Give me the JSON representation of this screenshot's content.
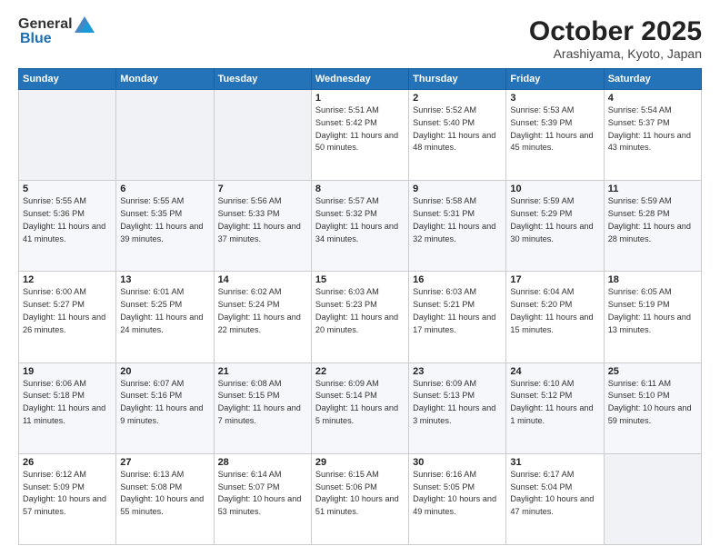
{
  "header": {
    "logo_general": "General",
    "logo_blue": "Blue",
    "month_title": "October 2025",
    "location": "Arashiyama, Kyoto, Japan"
  },
  "weekdays": [
    "Sunday",
    "Monday",
    "Tuesday",
    "Wednesday",
    "Thursday",
    "Friday",
    "Saturday"
  ],
  "weeks": [
    [
      {
        "day": "",
        "sunrise": "",
        "sunset": "",
        "daylight": ""
      },
      {
        "day": "",
        "sunrise": "",
        "sunset": "",
        "daylight": ""
      },
      {
        "day": "",
        "sunrise": "",
        "sunset": "",
        "daylight": ""
      },
      {
        "day": "1",
        "sunrise": "Sunrise: 5:51 AM",
        "sunset": "Sunset: 5:42 PM",
        "daylight": "Daylight: 11 hours and 50 minutes."
      },
      {
        "day": "2",
        "sunrise": "Sunrise: 5:52 AM",
        "sunset": "Sunset: 5:40 PM",
        "daylight": "Daylight: 11 hours and 48 minutes."
      },
      {
        "day": "3",
        "sunrise": "Sunrise: 5:53 AM",
        "sunset": "Sunset: 5:39 PM",
        "daylight": "Daylight: 11 hours and 45 minutes."
      },
      {
        "day": "4",
        "sunrise": "Sunrise: 5:54 AM",
        "sunset": "Sunset: 5:37 PM",
        "daylight": "Daylight: 11 hours and 43 minutes."
      }
    ],
    [
      {
        "day": "5",
        "sunrise": "Sunrise: 5:55 AM",
        "sunset": "Sunset: 5:36 PM",
        "daylight": "Daylight: 11 hours and 41 minutes."
      },
      {
        "day": "6",
        "sunrise": "Sunrise: 5:55 AM",
        "sunset": "Sunset: 5:35 PM",
        "daylight": "Daylight: 11 hours and 39 minutes."
      },
      {
        "day": "7",
        "sunrise": "Sunrise: 5:56 AM",
        "sunset": "Sunset: 5:33 PM",
        "daylight": "Daylight: 11 hours and 37 minutes."
      },
      {
        "day": "8",
        "sunrise": "Sunrise: 5:57 AM",
        "sunset": "Sunset: 5:32 PM",
        "daylight": "Daylight: 11 hours and 34 minutes."
      },
      {
        "day": "9",
        "sunrise": "Sunrise: 5:58 AM",
        "sunset": "Sunset: 5:31 PM",
        "daylight": "Daylight: 11 hours and 32 minutes."
      },
      {
        "day": "10",
        "sunrise": "Sunrise: 5:59 AM",
        "sunset": "Sunset: 5:29 PM",
        "daylight": "Daylight: 11 hours and 30 minutes."
      },
      {
        "day": "11",
        "sunrise": "Sunrise: 5:59 AM",
        "sunset": "Sunset: 5:28 PM",
        "daylight": "Daylight: 11 hours and 28 minutes."
      }
    ],
    [
      {
        "day": "12",
        "sunrise": "Sunrise: 6:00 AM",
        "sunset": "Sunset: 5:27 PM",
        "daylight": "Daylight: 11 hours and 26 minutes."
      },
      {
        "day": "13",
        "sunrise": "Sunrise: 6:01 AM",
        "sunset": "Sunset: 5:25 PM",
        "daylight": "Daylight: 11 hours and 24 minutes."
      },
      {
        "day": "14",
        "sunrise": "Sunrise: 6:02 AM",
        "sunset": "Sunset: 5:24 PM",
        "daylight": "Daylight: 11 hours and 22 minutes."
      },
      {
        "day": "15",
        "sunrise": "Sunrise: 6:03 AM",
        "sunset": "Sunset: 5:23 PM",
        "daylight": "Daylight: 11 hours and 20 minutes."
      },
      {
        "day": "16",
        "sunrise": "Sunrise: 6:03 AM",
        "sunset": "Sunset: 5:21 PM",
        "daylight": "Daylight: 11 hours and 17 minutes."
      },
      {
        "day": "17",
        "sunrise": "Sunrise: 6:04 AM",
        "sunset": "Sunset: 5:20 PM",
        "daylight": "Daylight: 11 hours and 15 minutes."
      },
      {
        "day": "18",
        "sunrise": "Sunrise: 6:05 AM",
        "sunset": "Sunset: 5:19 PM",
        "daylight": "Daylight: 11 hours and 13 minutes."
      }
    ],
    [
      {
        "day": "19",
        "sunrise": "Sunrise: 6:06 AM",
        "sunset": "Sunset: 5:18 PM",
        "daylight": "Daylight: 11 hours and 11 minutes."
      },
      {
        "day": "20",
        "sunrise": "Sunrise: 6:07 AM",
        "sunset": "Sunset: 5:16 PM",
        "daylight": "Daylight: 11 hours and 9 minutes."
      },
      {
        "day": "21",
        "sunrise": "Sunrise: 6:08 AM",
        "sunset": "Sunset: 5:15 PM",
        "daylight": "Daylight: 11 hours and 7 minutes."
      },
      {
        "day": "22",
        "sunrise": "Sunrise: 6:09 AM",
        "sunset": "Sunset: 5:14 PM",
        "daylight": "Daylight: 11 hours and 5 minutes."
      },
      {
        "day": "23",
        "sunrise": "Sunrise: 6:09 AM",
        "sunset": "Sunset: 5:13 PM",
        "daylight": "Daylight: 11 hours and 3 minutes."
      },
      {
        "day": "24",
        "sunrise": "Sunrise: 6:10 AM",
        "sunset": "Sunset: 5:12 PM",
        "daylight": "Daylight: 11 hours and 1 minute."
      },
      {
        "day": "25",
        "sunrise": "Sunrise: 6:11 AM",
        "sunset": "Sunset: 5:10 PM",
        "daylight": "Daylight: 10 hours and 59 minutes."
      }
    ],
    [
      {
        "day": "26",
        "sunrise": "Sunrise: 6:12 AM",
        "sunset": "Sunset: 5:09 PM",
        "daylight": "Daylight: 10 hours and 57 minutes."
      },
      {
        "day": "27",
        "sunrise": "Sunrise: 6:13 AM",
        "sunset": "Sunset: 5:08 PM",
        "daylight": "Daylight: 10 hours and 55 minutes."
      },
      {
        "day": "28",
        "sunrise": "Sunrise: 6:14 AM",
        "sunset": "Sunset: 5:07 PM",
        "daylight": "Daylight: 10 hours and 53 minutes."
      },
      {
        "day": "29",
        "sunrise": "Sunrise: 6:15 AM",
        "sunset": "Sunset: 5:06 PM",
        "daylight": "Daylight: 10 hours and 51 minutes."
      },
      {
        "day": "30",
        "sunrise": "Sunrise: 6:16 AM",
        "sunset": "Sunset: 5:05 PM",
        "daylight": "Daylight: 10 hours and 49 minutes."
      },
      {
        "day": "31",
        "sunrise": "Sunrise: 6:17 AM",
        "sunset": "Sunset: 5:04 PM",
        "daylight": "Daylight: 10 hours and 47 minutes."
      },
      {
        "day": "",
        "sunrise": "",
        "sunset": "",
        "daylight": ""
      }
    ]
  ]
}
